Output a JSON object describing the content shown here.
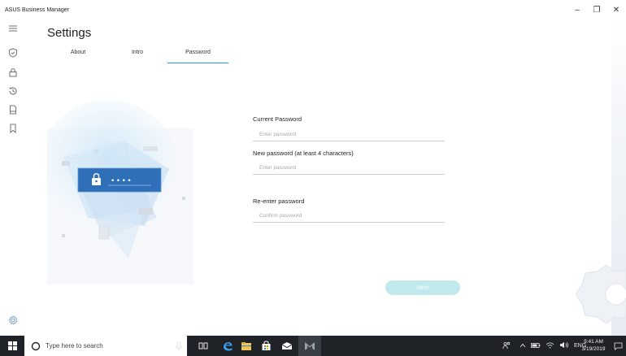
{
  "window": {
    "title": "ASUS Business Manager",
    "controls": {
      "minimize": "–",
      "maximize": "❐",
      "close": "✕"
    }
  },
  "page": {
    "title": "Settings",
    "tabs": [
      {
        "label": "About",
        "active": false
      },
      {
        "label": "Intro",
        "active": false
      },
      {
        "label": "Password",
        "active": true
      }
    ]
  },
  "sidebar": {
    "icons": [
      "hamburger-menu-icon",
      "shield-icon",
      "lock-icon",
      "history-icon",
      "document-icon",
      "bookmark-icon"
    ],
    "bottom_icon": "settings-gear-icon"
  },
  "illustration": {
    "mask": "••••"
  },
  "form": {
    "current": {
      "label": "Current Password",
      "placeholder": "Enter password"
    },
    "new": {
      "label": "New password (at least 4 characters)",
      "placeholder": "Enter password"
    },
    "reenter": {
      "label": "Re-enter password",
      "placeholder": "Confirm password"
    },
    "next_label": "Next"
  },
  "taskbar": {
    "search_placeholder": "Type here to search",
    "tray": {
      "lang": "ENG"
    },
    "clock": {
      "time": "9:41 AM",
      "date": "3/19/2019"
    }
  },
  "colors": {
    "accent": "#2b9bd6",
    "next_button": "#bfe9ec",
    "lock_card": "#2f6fb8",
    "taskbar": "#1f2227"
  }
}
